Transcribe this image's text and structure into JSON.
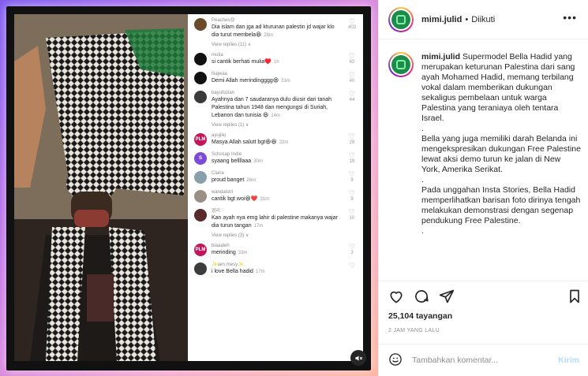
{
  "post": {
    "username": "mimi.julid",
    "separator": "•",
    "follow_status": "Diikuti",
    "more_icon": "more-horizontal-icon",
    "caption": [
      "Supermodel Bella Hadid yang merupakan keturunan Palestina dari sang ayah Mohamed Hadid, memang terbilang vokal dalam memberikan dukungan sekaligus pembelaan untuk warga Palestina yang teraniaya oleh tentara Israel.",
      ".",
      "Bella yang juga memiliki darah Belanda ini mengekspresikan dukungan Free Palestine lewat aksi demo turun ke jalan di New York, Amerika Serikat.",
      ".",
      "Pada unggahan Insta Stories, Bella Hadid memperlihatkan barisan foto dirinya tengah melakukan demonstrasi dengan segenap pendukung Free Palestine.",
      "."
    ],
    "views": "25,104 tayangan",
    "date": "2 JAM YANG LALU",
    "comment_placeholder": "Tambahkan komentar...",
    "post_button": "Kirim"
  },
  "colors": {
    "accent_link": "#b3dbff",
    "logo_green": "#1b8a4a"
  },
  "overlay_comments": [
    {
      "user": "Peaches😍",
      "text": "Dia islam dan jga ad kturunan palestin jd wajar klo dia turut membela😆",
      "time": "28m",
      "likes": "403",
      "replies": "View replies (11) ∨",
      "avatar": "#6b4a2a",
      "avatar_text": ""
    },
    {
      "user": "mutia",
      "text": "si cantik berhati mulia♥️",
      "time": "1h",
      "likes": "62",
      "replies": "",
      "avatar": "#111111",
      "avatar_text": ""
    },
    {
      "user": "Najwaa",
      "text": "Demi Allah merindingggg😆",
      "time": "31m",
      "likes": "40",
      "replies": "",
      "avatar": "#111111",
      "avatar_text": ""
    },
    {
      "user": "bayufozian",
      "text": "Ayahnya dan 7 saudaranya dulu diusir dari tanah Palestina tahun 1948 dan mengungsi di Suriah, Lebanon dan tunisia 😆",
      "time": "14m",
      "likes": "44",
      "replies": "View replies (1) ∨",
      "avatar": "#3a3a3a",
      "avatar_text": ""
    },
    {
      "user": "ayujiiio",
      "text": "Masya Allah salutt bgt😆😆",
      "time": "22m",
      "likes": "29",
      "replies": "",
      "avatar": "#c2185b",
      "avatar_text": "PLM"
    },
    {
      "user": "Schosap Indie",
      "text": "syaang bellllaaa",
      "time": "30m",
      "likes": "19",
      "replies": "",
      "avatar": "#7b4bd8",
      "avatar_text": "S"
    },
    {
      "user": "Claira",
      "text": "proud banget",
      "time": "26m",
      "likes": "9",
      "replies": "",
      "avatar": "#8aa0a8",
      "avatar_text": ""
    },
    {
      "user": "wandalstri",
      "text": "cantik bgt woi😆❤️",
      "time": "31m",
      "likes": "9",
      "replies": "",
      "avatar": "#9a8f86",
      "avatar_text": ""
    },
    {
      "user": "영리♡",
      "text": "Kan ayah nya emg lahir di palestine makanya wajar dia turun tangan",
      "time": "17m",
      "likes": "10",
      "replies": "View replies (3) ∨",
      "avatar": "#5a2a2a",
      "avatar_text": ""
    },
    {
      "user": "biaaaleh",
      "text": "merinding",
      "time": "33m",
      "likes": "3",
      "replies": "",
      "avatar": "#c2185b",
      "avatar_text": "PLM"
    },
    {
      "user": "✨iam.mesy✨",
      "text": "i love Bella hadid",
      "time": "17m",
      "likes": "",
      "replies": "",
      "avatar": "#3c3c3c",
      "avatar_text": ""
    }
  ],
  "icons": {
    "like": "heart-icon",
    "comment": "comment-icon",
    "share": "share-icon",
    "save": "bookmark-icon",
    "emoji": "emoji-icon",
    "mute": "speaker-muted-icon"
  }
}
